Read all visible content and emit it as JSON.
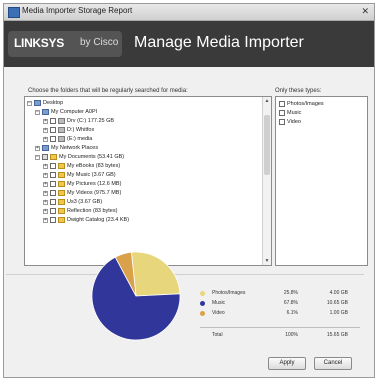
{
  "window": {
    "title": "Media Importer Storage Report",
    "close_glyph": "✕"
  },
  "banner": {
    "logo_main": "LINKSYS",
    "logo_sub": "by Cisco",
    "title": "Manage Media Importer"
  },
  "labels": {
    "folders": "Choose the folders that will be regularly searched for media:",
    "types": "Only these types:"
  },
  "tree": {
    "root": "Desktop",
    "computer": "My Computer A0PI",
    "drive1": "Drv (C:) 177.25 GB",
    "drive2": "D:) Whitfox",
    "drive3": "(E:) media",
    "network": "My Network Places",
    "documents": "My Documents (53.41 GB)",
    "albums": "My eBooks (83 bytes)",
    "music": "My Music (3.67 GB)",
    "pictures": "My Pictures (12.6 MB)",
    "videos": "My Videos (975.7 MB)",
    "usb": "Us3 (3.67 GB)",
    "reflection": "Reflection (83 bytes)",
    "catalog": "Dwight Catalog (23.4 KB)"
  },
  "types": [
    "Photos/Images",
    "Music",
    "Video"
  ],
  "legend": [
    {
      "name": "Photos/Images",
      "pct": "25.8%",
      "size": "4.00 GB",
      "color": "#e7d67b"
    },
    {
      "name": "Music",
      "pct": "67.8%",
      "size": "10.65 GB",
      "color": "#30369a"
    },
    {
      "name": "Video",
      "pct": "6.1%",
      "size": "1.00 GB",
      "color": "#d9a14a"
    }
  ],
  "total": {
    "name": "Total",
    "pct": "100%",
    "size": "15.65 GB"
  },
  "chart_data": {
    "type": "pie",
    "categories": [
      "Photos/Images",
      "Music",
      "Video"
    ],
    "values": [
      25.8,
      67.8,
      6.1
    ],
    "colors": [
      "#e7d67b",
      "#30369a",
      "#d9a14a"
    ]
  },
  "buttons": {
    "apply": "Apply",
    "cancel": "Cancel"
  }
}
